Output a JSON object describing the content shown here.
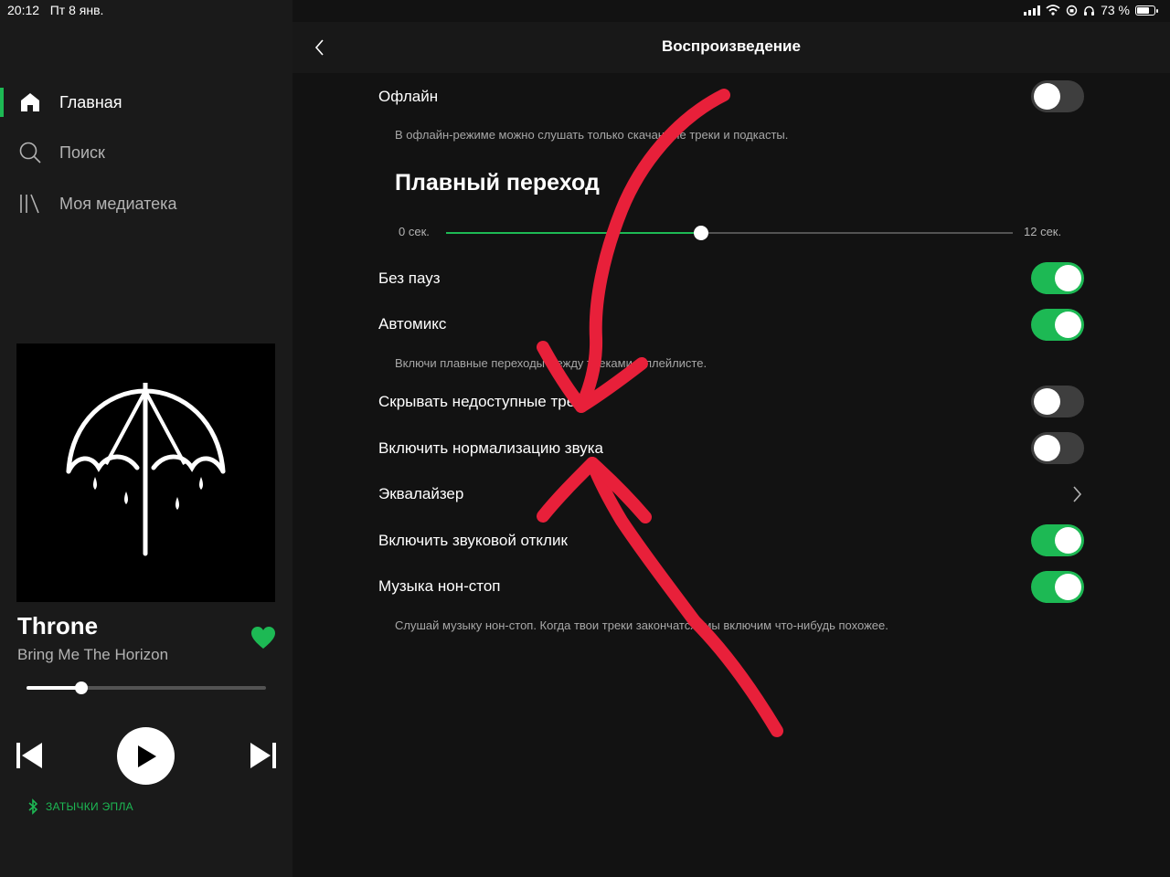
{
  "status_bar": {
    "time": "20:12",
    "date": "Пт 8 янв.",
    "battery": "73 %",
    "battery_level": 0.73
  },
  "sidebar": {
    "items": [
      {
        "label": "Главная",
        "icon": "home-icon",
        "active": true
      },
      {
        "label": "Поиск",
        "icon": "search-icon",
        "active": false
      },
      {
        "label": "Моя медиатека",
        "icon": "library-icon",
        "active": false
      }
    ]
  },
  "player": {
    "title": "Throne",
    "artist": "Bring Me The Horizon",
    "liked": true,
    "progress": 0.23,
    "device": "ЗАТЫЧКИ ЭПЛА"
  },
  "header": {
    "title": "Воспроизведение"
  },
  "settings": {
    "offline": {
      "label": "Офлайн",
      "on": false,
      "desc": "В офлайн-режиме можно слушать только скачанные треки и подкасты."
    },
    "crossfade": {
      "title": "Плавный переход",
      "min": "0 сек.",
      "max": "12 сек.",
      "value": 0.45
    },
    "gapless": {
      "label": "Без пауз",
      "on": true
    },
    "automix": {
      "label": "Автомикс",
      "on": true,
      "desc": "Включи плавные переходы между треками в плейлисте."
    },
    "hide_unplayable": {
      "label": "Скрывать недоступные треки",
      "on": false
    },
    "normalize": {
      "label": "Включить нормализацию звука",
      "on": false
    },
    "equalizer": {
      "label": "Эквалайзер"
    },
    "feedback": {
      "label": "Включить звуковой отклик",
      "on": true
    },
    "autoplay": {
      "label": "Музыка нон-стоп",
      "on": true,
      "desc": "Слушай музыку нон-стоп. Когда твои треки закончатся, мы включим что-нибудь похожее."
    }
  },
  "colors": {
    "accent": "#1db954",
    "annotation": "#e8203a",
    "background": "#121212",
    "sidebar": "#1a1a1a"
  }
}
